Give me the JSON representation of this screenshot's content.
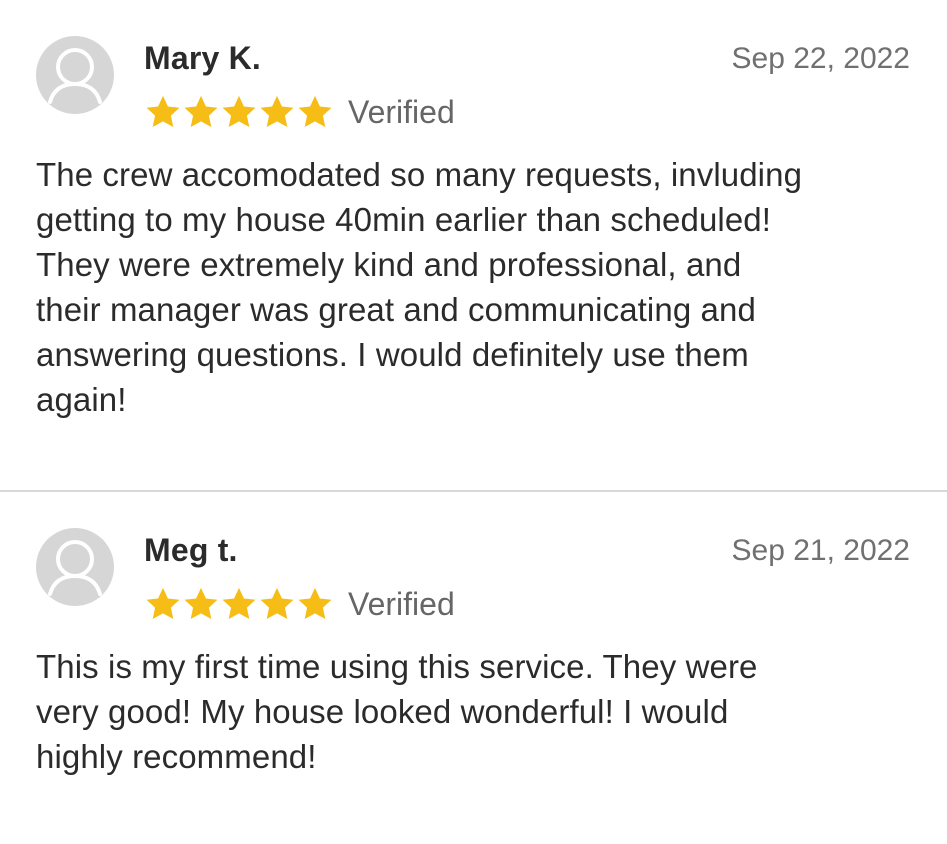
{
  "reviews": [
    {
      "name": "Mary K.",
      "date": "Sep 22, 2022",
      "rating": 5,
      "verified_label": "Verified",
      "body_lines": [
        "The crew accomodated so many requests, invluding",
        "getting to my house 40min earlier than scheduled!",
        "They were extremely kind and professional, and",
        "their manager was great and communicating and",
        "answering questions. I would definitely use them",
        "again!"
      ]
    },
    {
      "name": "Meg t.",
      "date": "Sep 21, 2022",
      "rating": 5,
      "verified_label": "Verified",
      "body_lines": [
        "This is my first time using this service. They were",
        "very good! My house looked wonderful! I would",
        "highly recommend!"
      ]
    }
  ],
  "colors": {
    "star": "#f6bd16",
    "avatar_bg": "#d6d6d6",
    "avatar_fg": "#ffffff",
    "divider": "#d9d9d9",
    "muted_text": "#707070"
  },
  "icons": {
    "avatar": "user-silhouette-icon",
    "star": "star-icon"
  }
}
